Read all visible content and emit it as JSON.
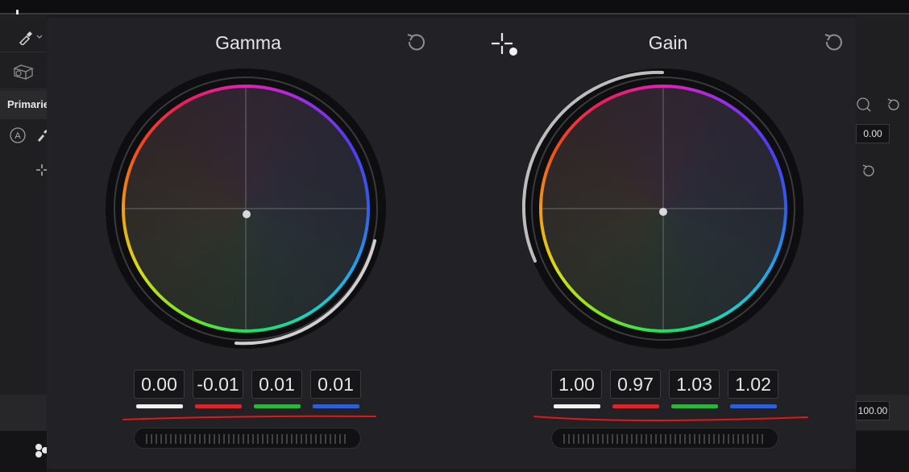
{
  "window": {
    "left_sidebar": {
      "tab_label": "Primaries"
    },
    "right_sidebar": {
      "top_value": "0.00",
      "bottom_value": "100.00"
    }
  },
  "wheels": [
    {
      "title": "Gamma",
      "values": [
        "0.00",
        "-0.01",
        "0.01",
        "0.01"
      ],
      "channels": [
        "master",
        "red",
        "green",
        "blue"
      ]
    },
    {
      "title": "Gain",
      "values": [
        "1.00",
        "0.97",
        "1.03",
        "1.02"
      ],
      "channels": [
        "master",
        "red",
        "green",
        "blue"
      ]
    }
  ],
  "channel_colors": {
    "master": "#f2f2f2",
    "red": "#d8262a",
    "green": "#2fb33c",
    "blue": "#2f5fd6"
  },
  "annotation_color": "#e01818",
  "icons": [
    "eyedropper-icon",
    "reset-icon",
    "crosshair-icon",
    "auto-balance-icon"
  ]
}
